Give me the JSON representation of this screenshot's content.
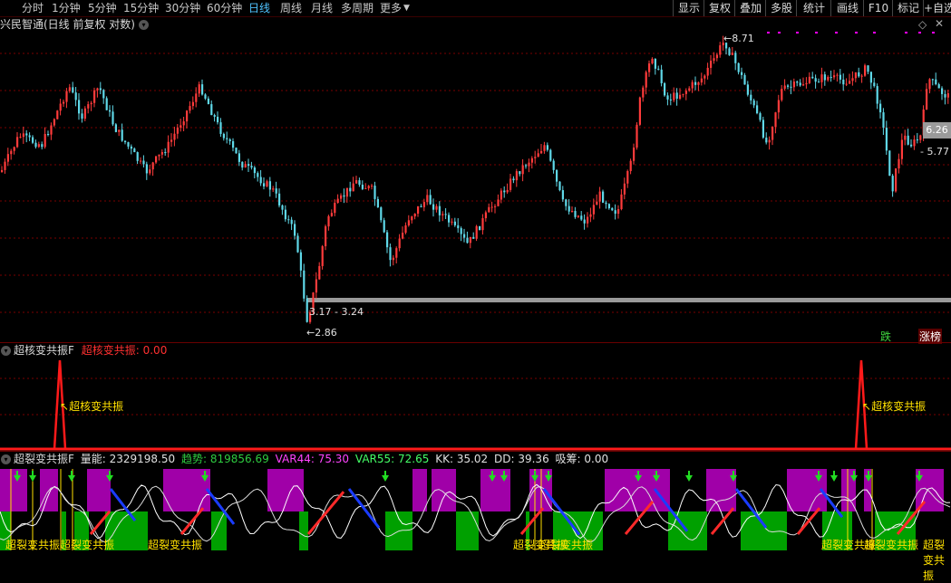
{
  "toolbar": {
    "periods": [
      "分时",
      "1分钟",
      "5分钟",
      "15分钟",
      "30分钟",
      "60分钟",
      "日线",
      "周线",
      "月线",
      "多周期",
      "更多"
    ],
    "active_period": "日线",
    "right_buttons": [
      "显示",
      "复权",
      "叠加",
      "多股",
      "统计",
      "画线",
      "F10",
      "标记",
      "+自选"
    ]
  },
  "main_panel": {
    "title": "兴民智通(日线 前复权 对数)",
    "high_label": "8.71",
    "low_label": "2.86",
    "range_label": "3.17 - 3.24",
    "price_box": "6.26",
    "price_right": "5.77",
    "tag_down": "跌",
    "tag_board": "涨榜"
  },
  "panel2": {
    "name": "超核变共振F",
    "indicator_label": "超核变共振",
    "indicator_value": "0.00",
    "signal_label": "超核变共振"
  },
  "panel3": {
    "name": "超裂变共振F",
    "fields": [
      {
        "label": "量能",
        "value": "2329198.50",
        "color": "#e0e0e0"
      },
      {
        "label": "趋势",
        "value": "819856.69",
        "color": "#2ecc40"
      },
      {
        "label": "VAR44",
        "value": "75.30",
        "color": "#ff44ff"
      },
      {
        "label": "VAR55",
        "value": "72.65",
        "color": "#44ff66"
      },
      {
        "label": "KK",
        "value": "35.02",
        "color": "#e0e0e0"
      },
      {
        "label": "DD",
        "value": "39.36",
        "color": "#e0e0e0"
      },
      {
        "label": "吸筹",
        "value": "0.00",
        "color": "#e0e0e0"
      }
    ],
    "signal_label": "超裂变共振",
    "signal_label_2": "超裂变共振"
  },
  "colors": {
    "up": "#ff3b3b",
    "down": "#5fd8e8",
    "grid": "#7a0000",
    "magenta": "#a000a8",
    "green": "#00a000"
  }
}
